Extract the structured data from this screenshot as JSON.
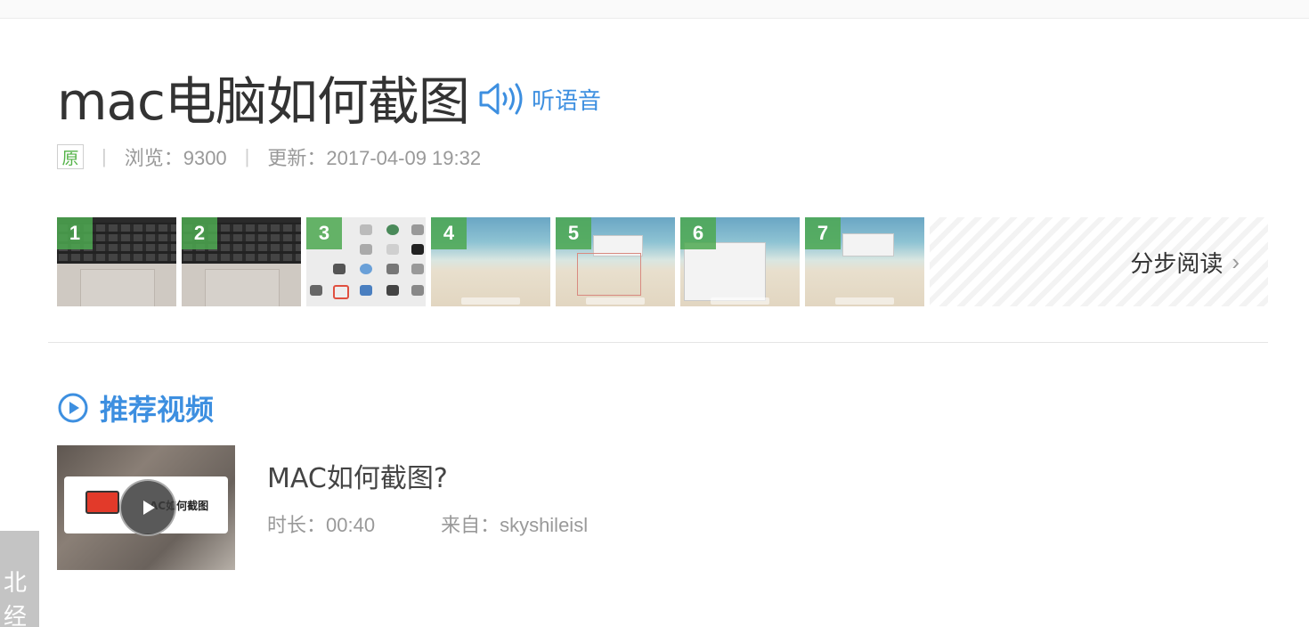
{
  "article": {
    "title": "mac电脑如何截图",
    "listen_label": "听语音",
    "badge": "原",
    "views": "浏览：9300",
    "updated": "更新：2017-04-09 19:32"
  },
  "steps": {
    "numbers": [
      "1",
      "2",
      "3",
      "4",
      "5",
      "6",
      "7"
    ],
    "read_more_label": "分步阅读",
    "read_more_chevron": "›"
  },
  "recommend": {
    "heading": "推荐视频",
    "video": {
      "thumb_caption": "AC如何截图",
      "title": "MAC如何截图?",
      "duration": "时长：00:40",
      "source": "来自：skyshileisl"
    }
  },
  "side_tab": {
    "line1": "北",
    "line2": "经"
  },
  "colors": {
    "accent_blue": "#3d8fe0",
    "step_green": "#4ca850",
    "badge_green": "#54b348"
  }
}
